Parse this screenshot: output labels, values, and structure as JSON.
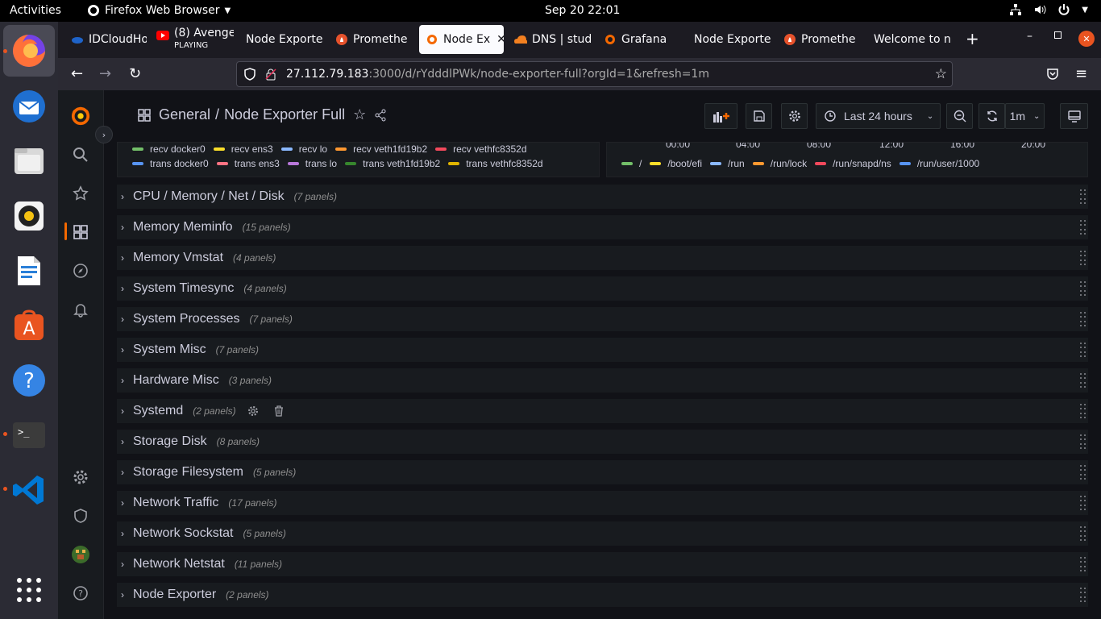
{
  "ubuntu": {
    "activities": "Activities",
    "app_name": "Firefox Web Browser",
    "clock": "Sep 20  22:01"
  },
  "dock": {
    "apps": [
      "firefox-icon",
      "thunderbird-icon",
      "files-icon",
      "rhythmbox-icon",
      "writer-icon",
      "app-center-icon",
      "help-icon",
      "terminal-icon",
      "vscode-icon",
      "show-apps-icon"
    ]
  },
  "tabs": [
    {
      "label": "IDCloudHo",
      "icon": "idcloudhost-icon"
    },
    {
      "label": "(8) Avenge",
      "sub": "PLAYING",
      "icon": "youtube-icon"
    },
    {
      "label": "Node Exporte",
      "icon": "none"
    },
    {
      "label": "Promethe",
      "icon": "prometheus-icon"
    },
    {
      "label": "Node Ex",
      "icon": "grafana-icon",
      "active": true
    },
    {
      "label": "DNS | stud",
      "icon": "cloudflare-icon"
    },
    {
      "label": "Grafana",
      "icon": "grafana-icon"
    },
    {
      "label": "Node Exporte",
      "icon": "none"
    },
    {
      "label": "Promethe",
      "icon": "prometheus-icon"
    },
    {
      "label": "Welcome to n",
      "icon": "none"
    }
  ],
  "url": {
    "host": "27.112.79.183",
    "rest": ":3000/d/rYdddlPWk/node-exporter-full?orgId=1&refresh=1m"
  },
  "dashboard": {
    "folder": "General",
    "title": "Node Exporter Full",
    "time_range": "Last 24 hours",
    "refresh": "1m"
  },
  "legend_network": {
    "row1": [
      {
        "label": "recv docker0",
        "color": "#73bf69"
      },
      {
        "label": "recv ens3",
        "color": "#fade2a"
      },
      {
        "label": "recv lo",
        "color": "#8ab8ff"
      },
      {
        "label": "recv veth1fd19b2",
        "color": "#ff9830"
      },
      {
        "label": "recv vethfc8352d",
        "color": "#f2495c"
      }
    ],
    "row2": [
      {
        "label": "trans docker0",
        "color": "#5794f2"
      },
      {
        "label": "trans ens3",
        "color": "#ff7383"
      },
      {
        "label": "trans lo",
        "color": "#b877d9"
      },
      {
        "label": "trans veth1fd19b2",
        "color": "#37872d"
      },
      {
        "label": "trans vethfc8352d",
        "color": "#e0b400"
      }
    ]
  },
  "legend_disk": {
    "ticks": [
      "00:00",
      "04:00",
      "08:00",
      "12:00",
      "16:00",
      "20:00"
    ],
    "items": [
      {
        "label": "/",
        "color": "#73bf69"
      },
      {
        "label": "/boot/efi",
        "color": "#fade2a"
      },
      {
        "label": "/run",
        "color": "#8ab8ff"
      },
      {
        "label": "/run/lock",
        "color": "#ff9830"
      },
      {
        "label": "/run/snapd/ns",
        "color": "#f2495c"
      },
      {
        "label": "/run/user/1000",
        "color": "#5794f2"
      }
    ]
  },
  "rows": [
    {
      "title": "CPU / Memory / Net / Disk",
      "panels": "(7 panels)"
    },
    {
      "title": "Memory Meminfo",
      "panels": "(15 panels)"
    },
    {
      "title": "Memory Vmstat",
      "panels": "(4 panels)"
    },
    {
      "title": "System Timesync",
      "panels": "(4 panels)"
    },
    {
      "title": "System Processes",
      "panels": "(7 panels)"
    },
    {
      "title": "System Misc",
      "panels": "(7 panels)"
    },
    {
      "title": "Hardware Misc",
      "panels": "(3 panels)"
    },
    {
      "title": "Systemd",
      "panels": "(2 panels)",
      "hovered": true
    },
    {
      "title": "Storage Disk",
      "panels": "(8 panels)"
    },
    {
      "title": "Storage Filesystem",
      "panels": "(5 panels)"
    },
    {
      "title": "Network Traffic",
      "panels": "(17 panels)"
    },
    {
      "title": "Network Sockstat",
      "panels": "(5 panels)"
    },
    {
      "title": "Network Netstat",
      "panels": "(11 panels)"
    },
    {
      "title": "Node Exporter",
      "panels": "(2 panels)"
    }
  ]
}
